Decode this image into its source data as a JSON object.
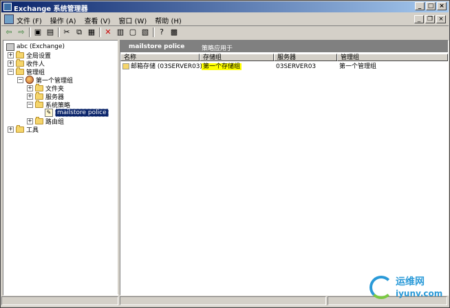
{
  "window": {
    "title": "Exchange 系统管理器"
  },
  "menu": [
    "文件 (F)",
    "操作 (A)",
    "查看 (V)",
    "窗口 (W)",
    "帮助 (H)"
  ],
  "toolbar": [
    "back-icon",
    "forward-icon",
    "up-folder-icon",
    "show-tree-icon",
    "cut-icon",
    "copy-icon",
    "paste-icon",
    "delete-icon",
    "properties-icon",
    "refresh-icon",
    "export-icon",
    "help-icon",
    "console-icon"
  ],
  "tree": {
    "root": "abc (Exchange)",
    "global": "全局设置",
    "recipients": "收件人",
    "admin_groups": "管理组",
    "first_group": "第一个管理组",
    "folders": "文件夹",
    "servers": "服务器",
    "system_policies": "系统策略",
    "policy": "mailstore police",
    "routing": "路由组",
    "tools": "工具"
  },
  "detail": {
    "header_name": "mailstore police",
    "header_tab": "策略应用于",
    "columns": [
      "名称",
      "存储组",
      "服务器",
      "管理组"
    ],
    "rows": [
      {
        "name": "邮箱存储 (03SERVER03)",
        "storage_group": "第一个存储组",
        "server": "03SERVER03",
        "admin_group": "第一个管理组"
      }
    ]
  },
  "watermark": {
    "cn": "运维网",
    "url": "iyunv.com"
  },
  "colors": {
    "title_start": "#0a246a",
    "title_end": "#a6caf0",
    "highlight": "#ffff00",
    "selection": "#0a246a"
  }
}
